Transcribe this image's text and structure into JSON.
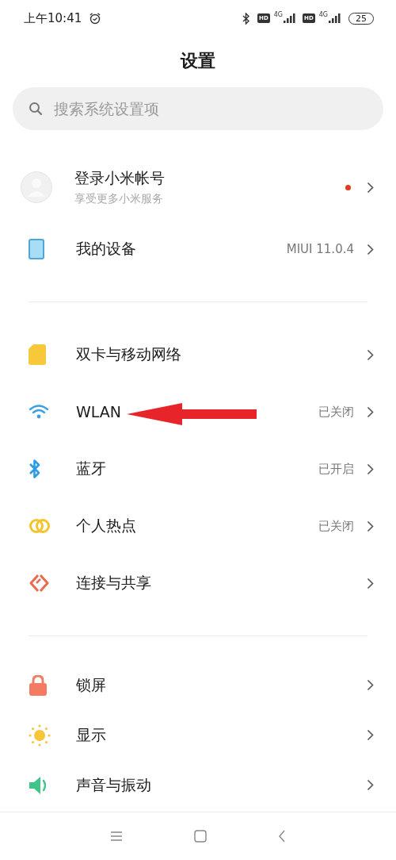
{
  "status_bar": {
    "time": "上午10:41",
    "sims": [
      {
        "hd": "HD",
        "network": "4G"
      },
      {
        "hd": "HD",
        "network": "4G"
      }
    ],
    "battery": "25"
  },
  "title": "设置",
  "search": {
    "placeholder": "搜索系统设置项"
  },
  "account": {
    "title": "登录小米帐号",
    "subtitle": "享受更多小米服务",
    "has_notification": true
  },
  "groups": [
    [
      {
        "kind": "tablet",
        "label": "我的设备",
        "value": "MIUI 11.0.4"
      }
    ],
    [
      {
        "kind": "sim",
        "label": "双卡与移动网络"
      },
      {
        "kind": "wifi",
        "label": "WLAN",
        "value": "已关闭"
      },
      {
        "kind": "bluetooth",
        "label": "蓝牙",
        "value": "已开启"
      },
      {
        "kind": "hotspot",
        "label": "个人热点",
        "value": "已关闭"
      },
      {
        "kind": "share",
        "label": "连接与共享"
      }
    ],
    [
      {
        "kind": "lock",
        "label": "锁屏"
      },
      {
        "kind": "sun",
        "label": "显示"
      },
      {
        "kind": "speaker",
        "label": "声音与振动"
      }
    ]
  ],
  "annotation": {
    "kind": "arrow"
  }
}
